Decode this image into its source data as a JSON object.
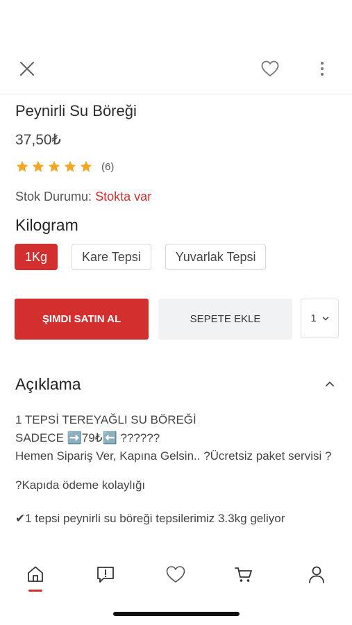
{
  "product": {
    "title": "Peynirli Su Böreği",
    "price": "37,50₺",
    "rating_stars": 5,
    "rating_count": "(6)",
    "stock_label": "Stok Durumu:",
    "stock_value": "Stokta var"
  },
  "variant_group": {
    "title": "Kilogram",
    "options": [
      "1Kg",
      "Kare Tepsi",
      "Yuvarlak Tepsi"
    ],
    "selected": "1Kg"
  },
  "actions": {
    "buy_now": "ŞIMDI SATIN AL",
    "add_to_cart": "SEPETE EKLE",
    "quantity": "1"
  },
  "description": {
    "title": "Açıklama",
    "line1": "1 TEPSİ TEREYAĞLI SU BÖREĞİ",
    "line2": "SADECE ➡️79₺⬅️ ??????",
    "line3": "Hemen Sipariş Ver, Kapına Gelsin.. ?Ücretsiz paket servisi ?",
    "line4": "?Kapıda ödeme kolaylığı",
    "line5": "✔1 tepsi peynirli su böreği tepsilerimiz 3.3kg geliyor"
  },
  "icons": {
    "top_left": "close-icon",
    "top_fav": "heart-icon",
    "top_more": "more-vertical-icon",
    "tabs": [
      "home-icon",
      "message-icon",
      "heart-icon",
      "cart-icon",
      "user-icon"
    ]
  },
  "colors": {
    "accent": "#d32f2f",
    "star": "#f5a623",
    "secondary_button": "#f1f2f4"
  }
}
